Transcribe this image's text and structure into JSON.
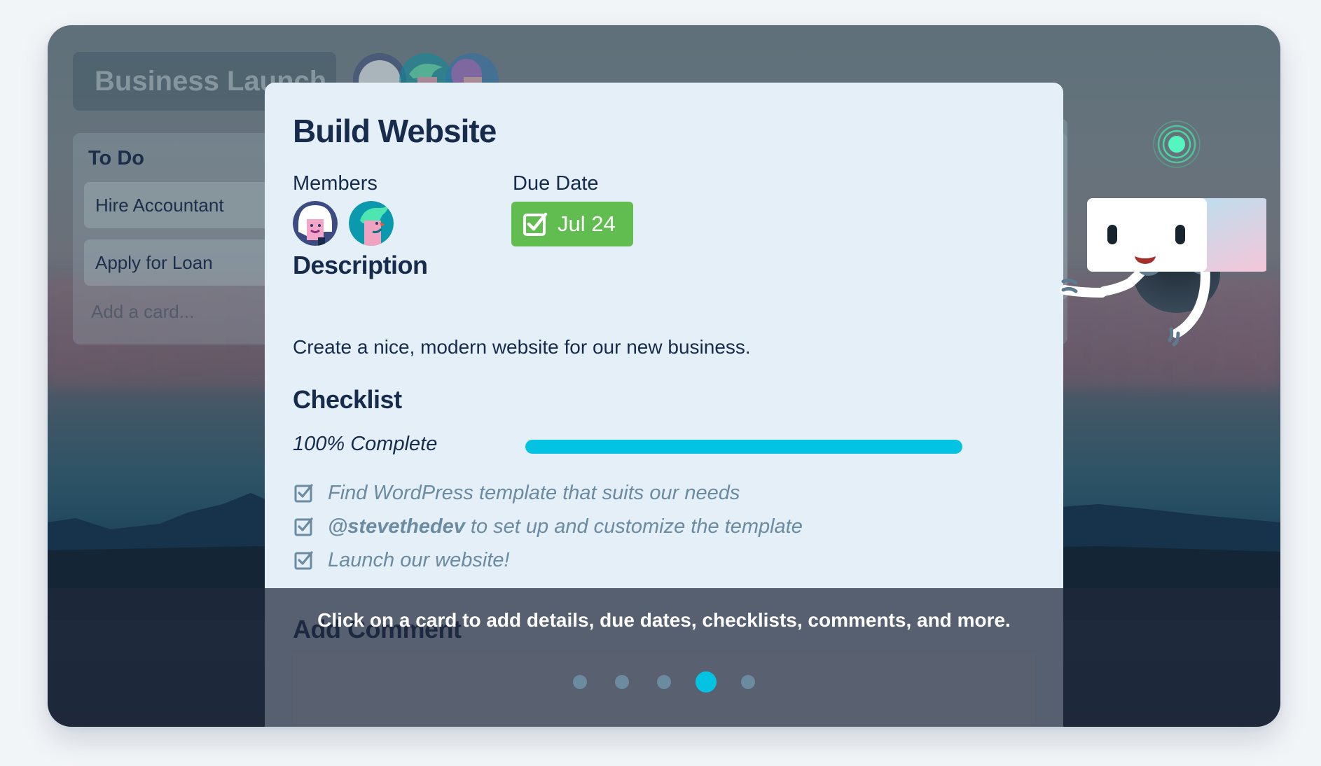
{
  "board": {
    "title": "Business Launch",
    "members": [
      "member-1",
      "member-2",
      "member-3"
    ],
    "list": {
      "title": "To Do",
      "cards": [
        "Hire Accountant",
        "Apply for Loan"
      ],
      "add_card_placeholder": "Add a card..."
    }
  },
  "card_modal": {
    "title": "Build Website",
    "members_label": "Members",
    "members": [
      "member-white-helmet",
      "member-green-hair"
    ],
    "due_date_label": "Due Date",
    "due_date": "Jul 24",
    "due_date_complete": true,
    "description_label": "Description",
    "description": "Create a nice, modern website for our new business.",
    "checklist_label": "Checklist",
    "checklist_progress_text": "100% Complete",
    "checklist_progress_percent": 100,
    "checklist_items": [
      {
        "mention": "",
        "text": "Find WordPress template that suits our needs",
        "checked": true
      },
      {
        "mention": "@stevethedev",
        "text": "to set up and customize the template",
        "checked": true
      },
      {
        "mention": "",
        "text": "Launch our website!",
        "checked": true
      }
    ],
    "add_comment_label": "Add Comment"
  },
  "tour": {
    "caption": "Click on a card to add details, due dates, checklists, comments, and more.",
    "total_steps": 5,
    "active_step": 4
  },
  "colors": {
    "accent": "#03C3E3",
    "due_green": "#61BD4F",
    "text_dark": "#172B4D",
    "check_muted": "#6A8BA1",
    "modal_bg": "#E4EFF7"
  }
}
